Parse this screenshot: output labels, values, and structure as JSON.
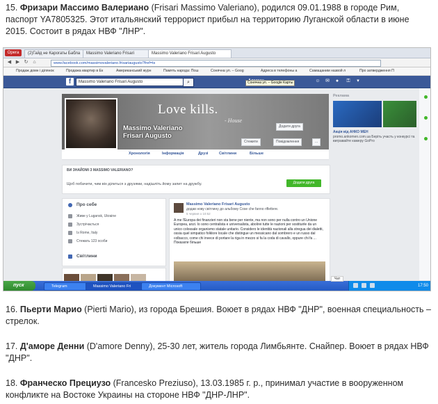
{
  "paragraphs": {
    "p15": {
      "num": "15. ",
      "name": "Фризари Массимо Валериано",
      "rest": " (Frisari Massimo Valeriano), родился 09.01.1988 в городе Рим, паспорт YA7805325. Этот итальянский террорист прибыл на территорию Луганской области в июне 2015. Состоит в рядах НВФ \"ЛНР\"."
    },
    "p16": {
      "num": "16. ",
      "name": "Пьерти Марио",
      "rest": " (Pierti Mario), из города Брешия. Воюет в рядах НВФ \"ДНР\", военная специальность – стрелок."
    },
    "p17": {
      "num": "17. ",
      "name": "Д'аморе Денни",
      "rest": " (D'amore Denny), 25-30 лет, житель города Лимбьянте. Снайпер. Воюет в рядах НВФ \"ДНР\"."
    },
    "p18": {
      "num": "18. ",
      "name": "Франческо Прециузо",
      "rest": " (Francesko Preziuso), 13.03.1985 г. р., принимал участие в вооруженном конфликте на Востоке Украины на стороне НВФ \"ДНР-ЛНР\"."
    }
  },
  "browser": {
    "opera_label": "Opera",
    "tabs": [
      "(2)Гайд не Карогаты Бабла",
      "Massimo Valeriano Frisari",
      "Massimo Valeriano Frisari Augusto"
    ],
    "url": "www.facebook.com/massimovaleriano.frisariaugusto?fref=ts",
    "bookmarks": [
      "Продаж домн і ділянок",
      "Продажа квартир в Ек",
      "Американський журн",
      "Память народа: Пош",
      "Сонячна ул. – Goog",
      "Адреса в телефоны а",
      "Самащаним назвой л",
      "Про затвердження П"
    ]
  },
  "facebook": {
    "logo": "f",
    "search_value": "Massimo Valeriano Frisari Augusto",
    "top_user": "Алексан",
    "tooltip": "Сонячна ул. – Google Карты",
    "cover_title": "Love kills.",
    "cover_sub": "- House",
    "profile_name_line1": "Massimo Valeriano",
    "profile_name_line2": "Frisari Augusto",
    "add_friend_btn": "Додати друга",
    "follow_btn": "Стежити",
    "message_btn": "Повідомлення",
    "more_btn": "...",
    "nav": [
      "Хронологія",
      "Інформація",
      "Друзі",
      "Світлини",
      "Більше"
    ],
    "know_heading": "ВИ ЗНАЙОМІ З MASSIMO VALERIANO?",
    "know_text": "Щоб побачити, чим він ділиться з друзями, надішліть йому запит на дружбу.",
    "know_btn": "Додати друга",
    "about_heading": "Про себе",
    "about_rows": [
      "Живе у Lugansk, Ukraine",
      "Зустрічається",
      "Із Rome, Italy",
      "Стежать 123 особи"
    ],
    "photos_heading": "Світлини",
    "post_name": "Massimo Valeriano Frisari Augusto",
    "post_meta": "додав нову світлину до альбому Cose che fanno riflettere.",
    "post_time": "5 червня о 10:52",
    "post_text": "A me l'Europa dei finanzieri non sta bene per niente, ma non sono per nulla contro un Unione Europea, anzi. Io sono centralista e universalista, abolirei tutte le nazioni per sostituirle da un unico colossale organismo statale unitario. Considero le identità nazionali alla stregua dei dialetti, ossia quel simpatico folklore locale che distingue un messicano dal sombrero e un russo dal colbacco, come chi invece di portare la riga in mezzo si fa la coda di cavallo, oppure chi fa ... Показати більше",
    "rec_heading": "Реклама",
    "ad_title": "Акція від АНКО МЕН",
    "ad_text": "promo.ankomen.com.ua Беріть участь у конкурсі та вигравайте камеру GoPro"
  },
  "taskbar": {
    "start": "пуск",
    "tasks": [
      "Telegram",
      "Massimo Valeriano Fri",
      "Документ Microsoft"
    ],
    "chat": "Чат",
    "clock": "17:50"
  }
}
